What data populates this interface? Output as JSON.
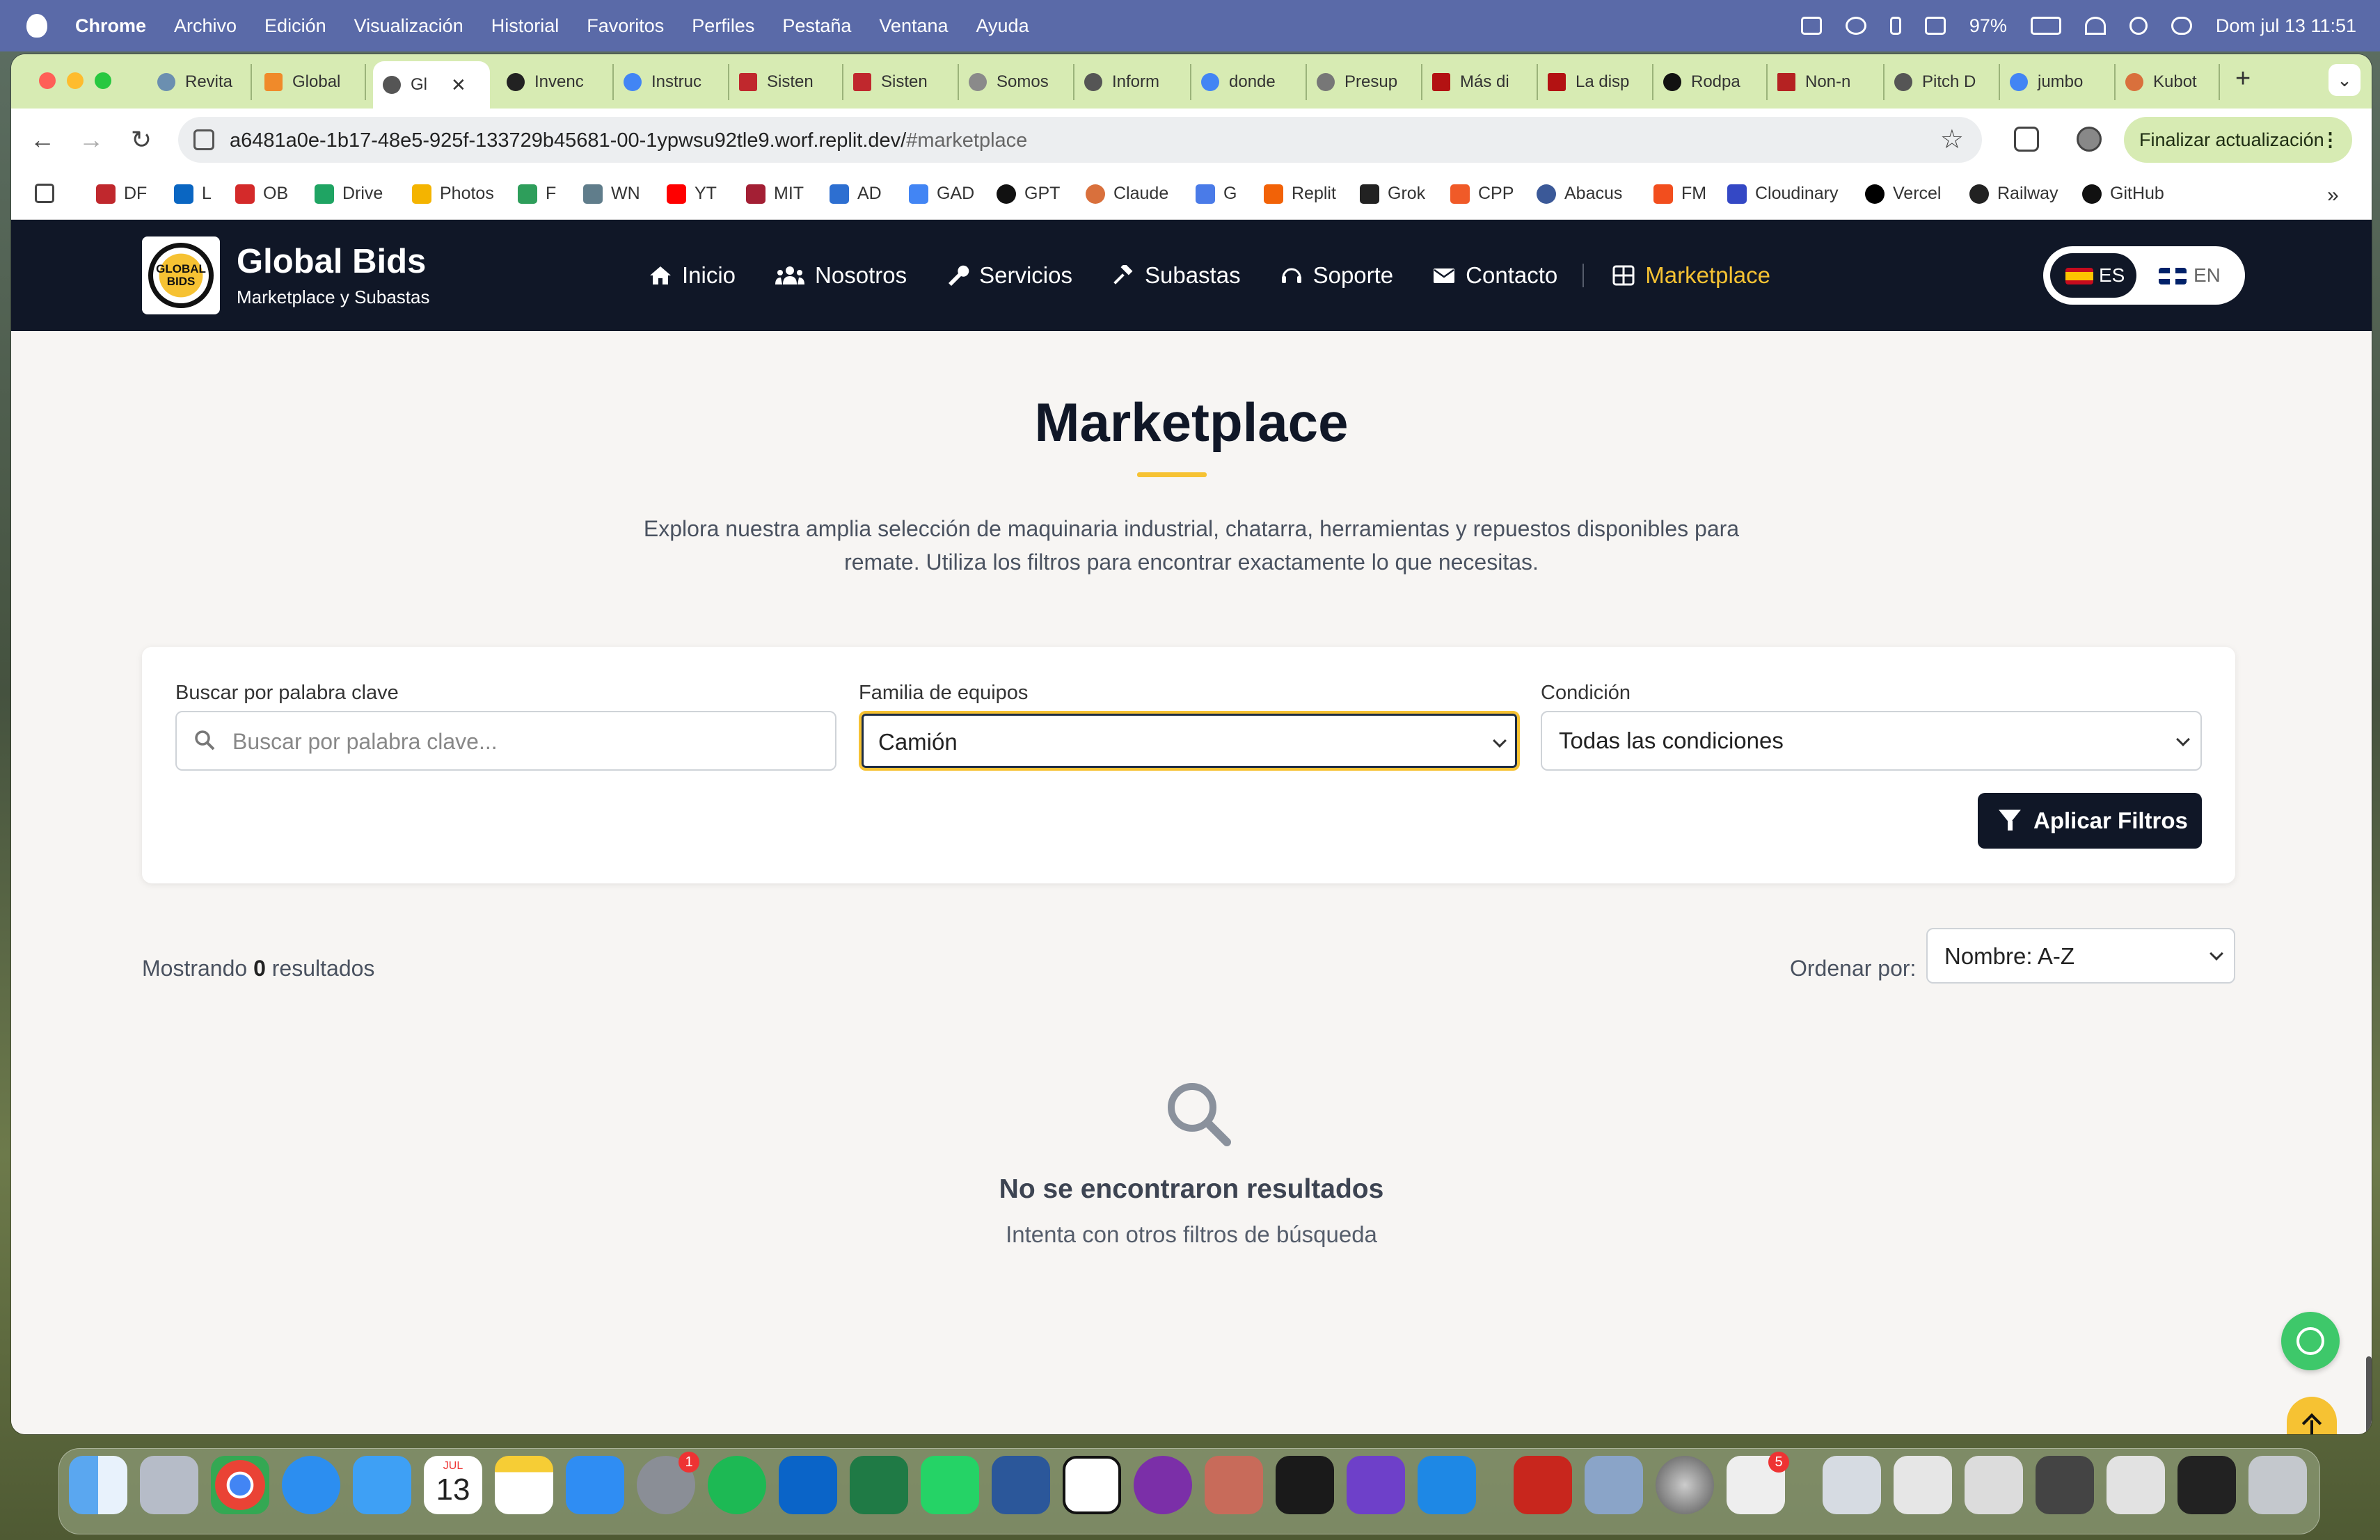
{
  "menubar": {
    "app": "Chrome",
    "items": [
      "Archivo",
      "Edición",
      "Visualización",
      "Historial",
      "Favoritos",
      "Perfiles",
      "Pestaña",
      "Ventana",
      "Ayuda"
    ],
    "battery": "97%",
    "datetime": "Dom jul 13  11:51"
  },
  "tabs": [
    {
      "label": "Revita"
    },
    {
      "label": "Global"
    },
    {
      "label": "Gl",
      "active": true,
      "close": "✕"
    },
    {
      "label": "Invenc"
    },
    {
      "label": "Instruc"
    },
    {
      "label": "Sisten"
    },
    {
      "label": "Sisten"
    },
    {
      "label": "Somos"
    },
    {
      "label": "Inform"
    },
    {
      "label": "donde"
    },
    {
      "label": "Presup"
    },
    {
      "label": "Más di"
    },
    {
      "label": "La disp"
    },
    {
      "label": "Rodpa"
    },
    {
      "label": "Non-n"
    },
    {
      "label": "Pitch D"
    },
    {
      "label": "jumbo"
    },
    {
      "label": "Kubot"
    }
  ],
  "toolbar": {
    "url_host": "a6481a0e-1b17-48e5-925f-133729b45681-00-1ypwsu92tle9.worf.replit.dev/",
    "url_path": "#marketplace",
    "update_label": "Finalizar actualización"
  },
  "bookmarks": [
    "DF",
    "L",
    "OB",
    "Drive",
    "Photos",
    "F",
    "WN",
    "YT",
    "MIT",
    "AD",
    "GAD",
    "GPT",
    "Claude",
    "G",
    "Replit",
    "Grok",
    "CPP",
    "Abacus",
    "FM",
    "Cloudinary",
    "Vercel",
    "Railway",
    "GitHub"
  ],
  "site": {
    "brand": "Global Bids",
    "tagline": "Marketplace y Subastas",
    "logo_text": "GLOBAL BIDS",
    "nav": [
      "Inicio",
      "Nosotros",
      "Servicios",
      "Subastas",
      "Soporte",
      "Contacto"
    ],
    "nav_active": "Marketplace",
    "lang_es": "ES",
    "lang_en": "EN"
  },
  "main": {
    "title": "Marketplace",
    "intro": "Explora nuestra amplia selección de maquinaria industrial, chatarra, herramientas y repuestos disponibles para remate. Utiliza los filtros para encontrar exactamente lo que necesitas.",
    "filters": {
      "keyword_label": "Buscar por palabra clave",
      "keyword_placeholder": "Buscar por palabra clave...",
      "family_label": "Familia de equipos",
      "family_value": "Camión",
      "condition_label": "Condición",
      "condition_value": "Todas las condiciones",
      "apply_label": "Aplicar Filtros"
    },
    "results_prefix": "Mostrando",
    "results_count": "0",
    "results_suffix": "resultados",
    "sort_label": "Ordenar por:",
    "sort_value": "Nombre: A-Z",
    "empty_title": "No se encontraron resultados",
    "empty_hint": "Intenta con otros filtros de búsqueda"
  },
  "dock": {
    "calendar_month": "JUL",
    "calendar_day": "13",
    "settings_badge": "1",
    "store_badge": "5"
  },
  "colors": {
    "navy": "#101727",
    "accent": "#f6c233",
    "whatsapp": "#3ec86a",
    "tabstrip": "#d7ebb3"
  }
}
